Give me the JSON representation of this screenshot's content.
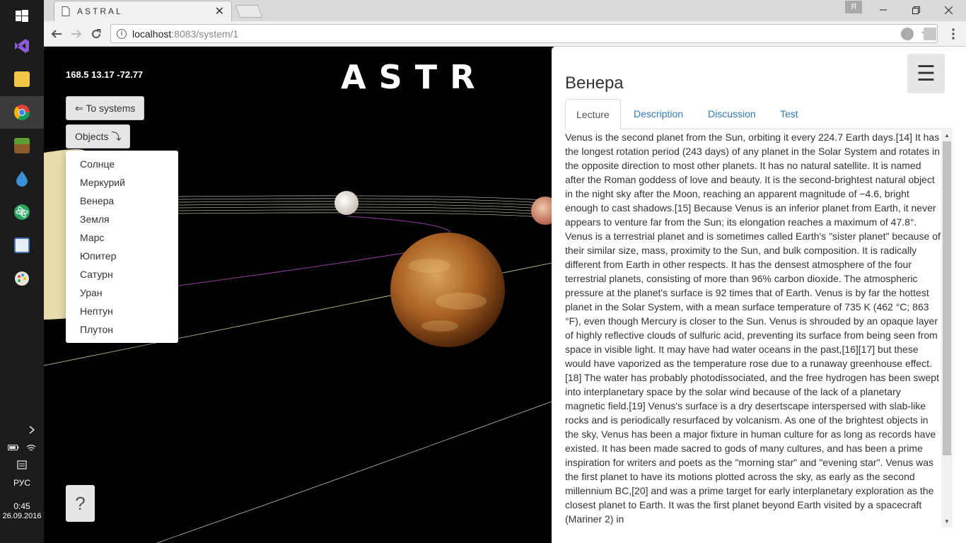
{
  "taskbar": {
    "icons": [
      "windows-start-icon",
      "visual-studio-icon",
      "file-explorer-icon",
      "chrome-icon",
      "minecraft-icon",
      "droplet-app-icon",
      "atom-icon",
      "presentation-icon",
      "paint-icon"
    ],
    "lang": "РУС",
    "time": "0:45",
    "date": "26.09.2016"
  },
  "browser": {
    "tab_title": "ASTRAL",
    "user_badge": "Я",
    "url_host": "localhost",
    "url_path": ":8083/system/1"
  },
  "scene": {
    "coords": "168.5 13.17 -72.77",
    "logo": "ASTR"
  },
  "controls": {
    "to_systems": "⇐ To systems",
    "objects": "Objects ⤵",
    "help": "?"
  },
  "objects_menu": [
    "Солнце",
    "Меркурий",
    "Венера",
    "Земля",
    "Марс",
    "Юпитер",
    "Сатурн",
    "Уран",
    "Нептун",
    "Плутон"
  ],
  "panel": {
    "title": "Венера",
    "menu_icon": "☰",
    "tabs": [
      "Lecture",
      "Description",
      "Discussion",
      "Test"
    ],
    "active_tab": "Lecture",
    "lecture": "Venus is the second planet from the Sun, orbiting it every 224.7 Earth days.[14] It has the longest rotation period (243 days) of any planet in the Solar System and rotates in the opposite direction to most other planets. It has no natural satellite. It is named after the Roman goddess of love and beauty. It is the second-brightest natural object in the night sky after the Moon, reaching an apparent magnitude of −4.6, bright enough to cast shadows.[15] Because Venus is an inferior planet from Earth, it never appears to venture far from the Sun; its elongation reaches a maximum of 47.8°. Venus is a terrestrial planet and is sometimes called Earth's \"sister planet\" because of their similar size, mass, proximity to the Sun, and bulk composition. It is radically different from Earth in other respects. It has the densest atmosphere of the four terrestrial planets, consisting of more than 96% carbon dioxide. The atmospheric pressure at the planet's surface is 92 times that of Earth. Venus is by far the hottest planet in the Solar System, with a mean surface temperature of 735 K (462 °C; 863 °F), even though Mercury is closer to the Sun. Venus is shrouded by an opaque layer of highly reflective clouds of sulfuric acid, preventing its surface from being seen from space in visible light. It may have had water oceans in the past,[16][17] but these would have vaporized as the temperature rose due to a runaway greenhouse effect.[18] The water has probably photodissociated, and the free hydrogen has been swept into interplanetary space by the solar wind because of the lack of a planetary magnetic field.[19] Venus's surface is a dry desertscape interspersed with slab-like rocks and is periodically resurfaced by volcanism. As one of the brightest objects in the sky, Venus has been a major fixture in human culture for as long as records have existed. It has been made sacred to gods of many cultures, and has been a prime inspiration for writers and poets as the \"morning star\" and \"evening star\". Venus was the first planet to have its motions plotted across the sky, as early as the second millennium BC,[20] and was a prime target for early interplanetary exploration as the closest planet to Earth. It was the first planet beyond Earth visited by a spacecraft (Mariner 2) in"
  }
}
